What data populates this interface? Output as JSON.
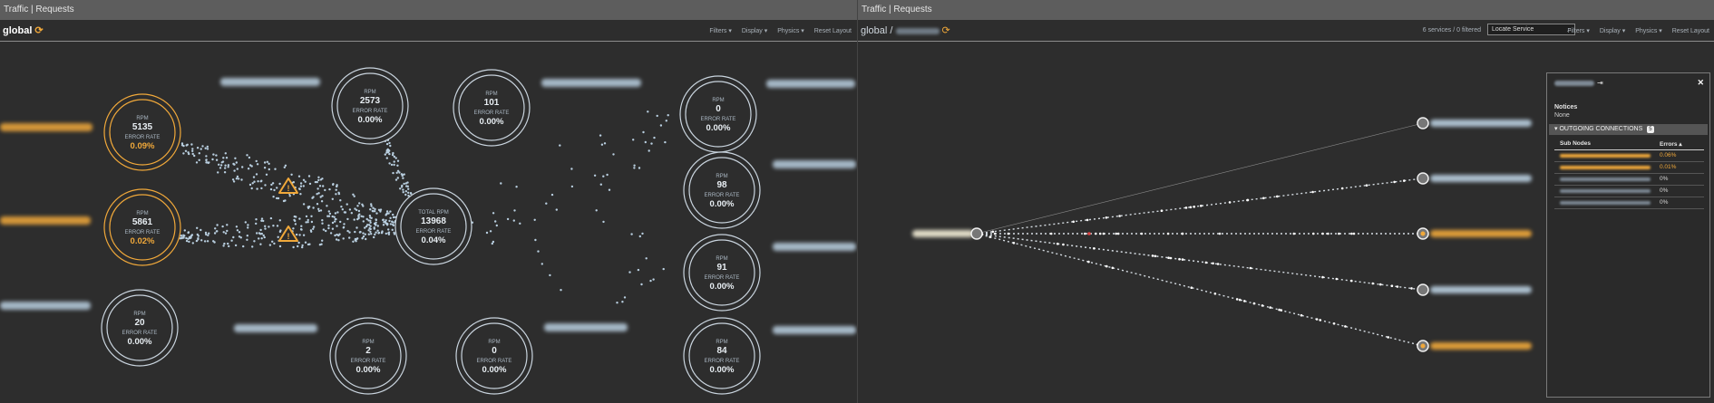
{
  "colors": {
    "warning": "#f0a83a",
    "ring": "#c9d4de",
    "dot": "#b9cfe0",
    "background": "#2d2d2d"
  },
  "left": {
    "window_title": "Traffic | Requests",
    "context_title": "global",
    "refresh_icon": "refresh-icon",
    "menus": [
      "Filters ▾",
      "Display ▾",
      "Physics ▾",
      "Reset Layout"
    ],
    "nodes": [
      {
        "id": "a1",
        "label": "RPM",
        "value": "5135",
        "err_label": "ERROR RATE",
        "err": "0.09%",
        "warn": true
      },
      {
        "id": "a2",
        "label": "RPM",
        "value": "5861",
        "err_label": "ERROR RATE",
        "err": "0.02%",
        "warn": true
      },
      {
        "id": "a3",
        "label": "RPM",
        "value": "20",
        "err_label": "ERROR RATE",
        "err": "0.00%",
        "warn": false
      },
      {
        "id": "b1",
        "label": "RPM",
        "value": "2573",
        "err_label": "ERROR RATE",
        "err": "0.00%",
        "warn": false
      },
      {
        "id": "b2",
        "label": "RPM",
        "value": "2",
        "err_label": "ERROR RATE",
        "err": "0.00%",
        "warn": false
      },
      {
        "id": "c",
        "label": "TOTAL RPM",
        "value": "13968",
        "err_label": "ERROR RATE",
        "err": "0.04%",
        "warn": false
      },
      {
        "id": "d1",
        "label": "RPM",
        "value": "101",
        "err_label": "ERROR RATE",
        "err": "0.00%",
        "warn": false
      },
      {
        "id": "d2",
        "label": "RPM",
        "value": "0",
        "err_label": "ERROR RATE",
        "err": "0.00%",
        "warn": false
      },
      {
        "id": "e1",
        "label": "RPM",
        "value": "0",
        "err_label": "ERROR RATE",
        "err": "0.00%",
        "warn": false
      },
      {
        "id": "e2",
        "label": "RPM",
        "value": "98",
        "err_label": "ERROR RATE",
        "err": "0.00%",
        "warn": false
      },
      {
        "id": "e3",
        "label": "RPM",
        "value": "91",
        "err_label": "ERROR RATE",
        "err": "0.00%",
        "warn": false
      },
      {
        "id": "e4",
        "label": "RPM",
        "value": "84",
        "err_label": "ERROR RATE",
        "err": "0.00%",
        "warn": false
      }
    ]
  },
  "right": {
    "window_title": "Traffic | Requests",
    "context_title": "global /",
    "service_count": "6 services / 0 filtered",
    "locate_placeholder": "Locate Service",
    "menus": [
      "Filters ▾",
      "Display ▾",
      "Physics ▾",
      "Reset Layout"
    ],
    "detail": {
      "notices_label": "Notices",
      "notices_value": "None",
      "section_label": "OUTGOING CONNECTIONS",
      "section_count": "5",
      "col_subnodes": "Sub Nodes",
      "col_errors": "Errors ▴",
      "rows": [
        {
          "err": "0.06%",
          "warn": true
        },
        {
          "err": "0.01%",
          "warn": true
        },
        {
          "err": "0%",
          "warn": false
        },
        {
          "err": "0%",
          "warn": false
        },
        {
          "err": "0%",
          "warn": false
        }
      ]
    },
    "targets_warn": [
      false,
      false,
      true,
      false,
      true
    ]
  }
}
